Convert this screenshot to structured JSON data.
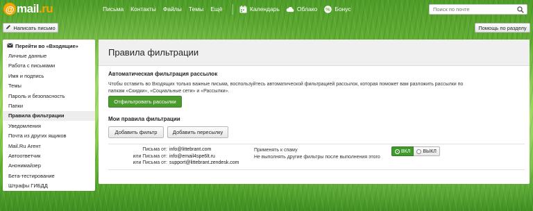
{
  "header": {
    "logo_mark": "@",
    "logo_text": "mail",
    "logo_tld": ".ru",
    "nav": [
      "Письма",
      "Контакты",
      "Файлы",
      "Темы",
      "Ещё"
    ],
    "services": [
      {
        "label": "Календарь",
        "icon": "calendar-icon"
      },
      {
        "label": "Облако",
        "icon": "cloud-icon"
      },
      {
        "label": "Бонус",
        "icon": "percent-icon"
      }
    ],
    "search_placeholder": "Поиск по почте"
  },
  "toolbar": {
    "compose_label": "Написать письмо",
    "help_label": "Помощь по разделу"
  },
  "sidebar": {
    "head_label": "Перейти во «Входящие»",
    "items": [
      {
        "label": "Личные данные",
        "active": false
      },
      {
        "label": "Работа с письмами",
        "active": false
      },
      {
        "label": "Имя и подпись",
        "active": false
      },
      {
        "label": "Темы",
        "active": false
      },
      {
        "label": "Пароль и безопасность",
        "active": false
      },
      {
        "label": "Папки",
        "active": false
      },
      {
        "label": "Правила фильтрации",
        "active": true
      },
      {
        "label": "Уведомления",
        "active": false
      },
      {
        "label": "Почта из других ящиков",
        "active": false
      },
      {
        "label": "Mail.Ru Агент",
        "active": false
      },
      {
        "label": "Автоответчик",
        "active": false
      },
      {
        "label": "Анонимайзер",
        "active": false
      },
      {
        "label": "Бета-тестирование",
        "active": false
      },
      {
        "label": "Штрафы ГИБДД",
        "active": false
      }
    ]
  },
  "main": {
    "title": "Правила фильтрации",
    "auto_filter": {
      "title": "Автоматическая фильтрация рассылок",
      "description": "Чтобы оставить во Входящих только важные письма, воспользуйтесь автоматической фильтрацией рассылок, которая поможет вам разложить рассылки по папкам «Скидки», «Социальные сети» и «Рассылки».",
      "button_label": "Отфильтровать рассылки"
    },
    "my_rules": {
      "title": "Мои правила фильтрации",
      "add_filter_label": "Добавить фильтр",
      "add_forward_label": "Добавить пересылку",
      "rule": {
        "conditions": [
          {
            "prefix": "Письма от:",
            "value": "info@littebrant.com"
          },
          {
            "prefix": "или Письма от:",
            "value": "info@email4spe6lt.ru"
          },
          {
            "prefix": "или Письма от:",
            "value": "support@littebrant.zendesk.com"
          }
        ],
        "actions": [
          "Применять к спаму",
          "Не выполнять другие фильтры после выполнения этого"
        ],
        "toggle_on_label": "ВКЛ",
        "toggle_off_label": "ВЫКЛ",
        "enabled": true
      }
    }
  },
  "colors": {
    "accent_green": "#4a9a2e",
    "logo_orange": "#f7a600"
  }
}
